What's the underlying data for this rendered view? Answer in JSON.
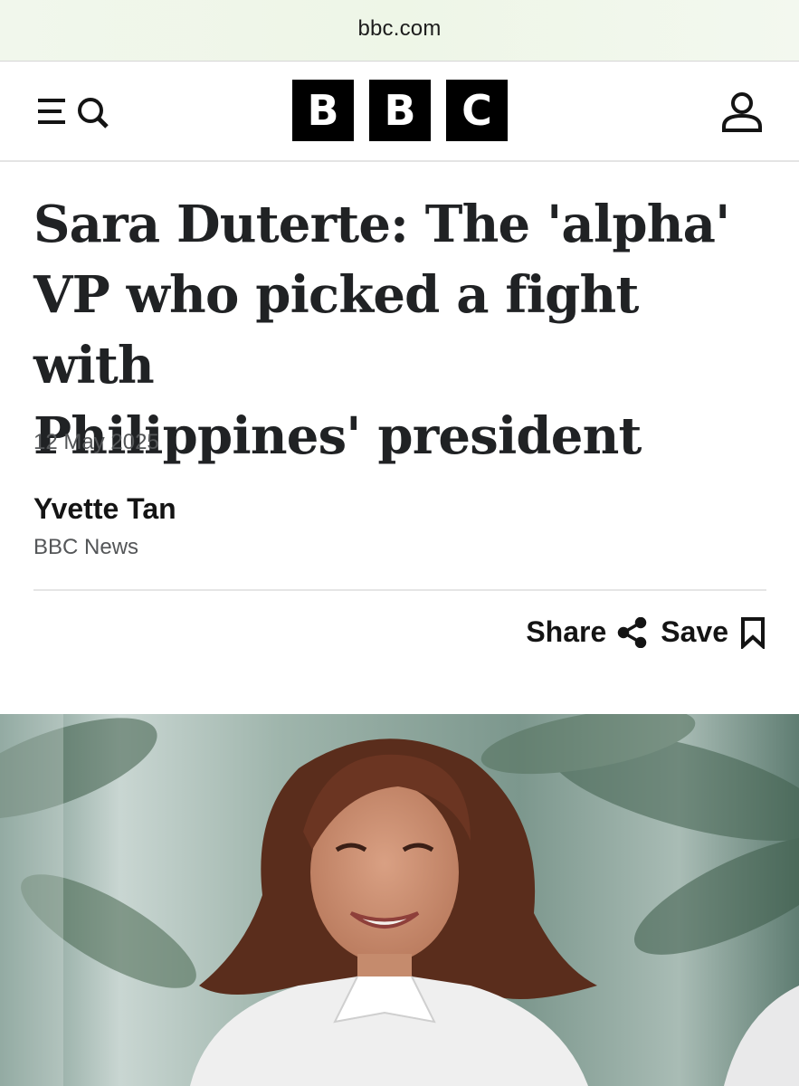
{
  "browser": {
    "domain": "bbc.com"
  },
  "header": {
    "logo_letters": [
      "B",
      "B",
      "C"
    ],
    "icons": {
      "menu": "menu-search-icon",
      "account": "user-icon"
    }
  },
  "article": {
    "headline_lines": [
      "Sara Duterte: The 'alpha'",
      "VP who picked a fight with",
      "Philippines' president"
    ],
    "date": "12 May 2025",
    "author": "Yvette Tan",
    "source": "BBC News",
    "share_label": "Share",
    "save_label": "Save",
    "icons": {
      "share": "share-icon",
      "save": "bookmark-icon"
    },
    "image_subject": "Smiling woman with shoulder-length brown hair in a white collared shirt, palm trees behind"
  },
  "colors": {
    "logo": "#000000",
    "text": "#141414",
    "muted": "#545658",
    "divider": "#e5e5e5"
  }
}
